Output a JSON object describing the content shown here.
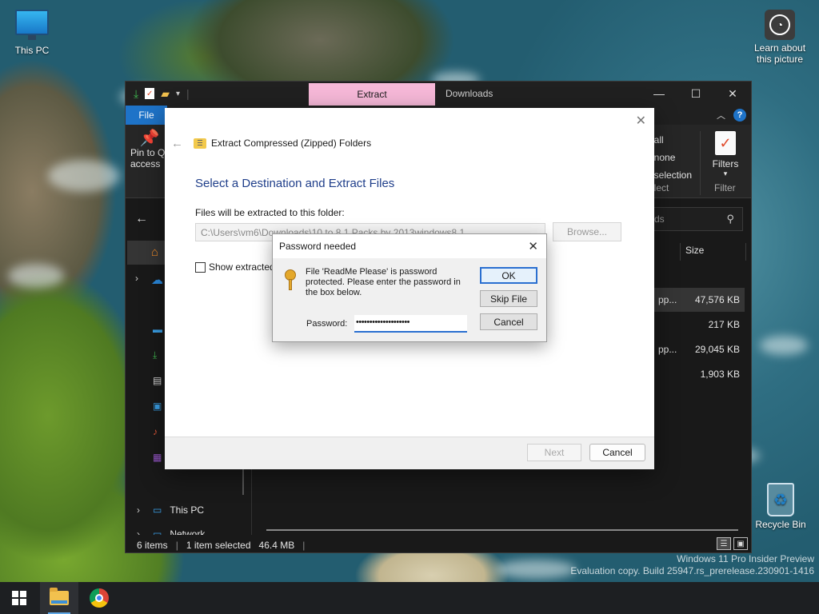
{
  "desktop": {
    "icons": [
      {
        "label": "This PC",
        "icon": "monitor-icon"
      },
      {
        "label": "Learn about\nthis picture",
        "icon": "camera-icon"
      },
      {
        "label": "Recycle Bin",
        "icon": "recycle-bin-icon"
      }
    ],
    "watermark": {
      "line1": "Windows 11 Pro Insider Preview",
      "line2": "Evaluation copy. Build 25947.rs_prerelease.230901-1416"
    }
  },
  "explorer": {
    "context_tab": "Extract",
    "title": "Downloads",
    "window_controls": {
      "minimize": "—",
      "maximize": "☐",
      "close": "✕"
    },
    "ribbon": {
      "file_tab": "File",
      "pin_label": "Pin to Quick access",
      "pin_label_visible": "Pin to Q\naccess",
      "select_items": [
        "ct all",
        "ct none",
        "ct selection"
      ],
      "select_items_visible": [
        "t all",
        "t none",
        "t selection"
      ],
      "select_group": "elect",
      "filters_label": "Filters",
      "filter_group": "Filter"
    },
    "search_placeholder": "ds",
    "nav": {
      "this_pc": "This PC",
      "network": "Network"
    },
    "list": {
      "size_header": "Size",
      "rows": [
        {
          "name": "pp...",
          "size": "47,576 KB",
          "selected": true
        },
        {
          "name": "",
          "size": "217 KB",
          "selected": false
        },
        {
          "name": "pp...",
          "size": "29,045 KB",
          "selected": false
        },
        {
          "name": "",
          "size": "1,903 KB",
          "selected": false
        }
      ]
    },
    "status": {
      "items": "6 items",
      "selection": "1 item selected",
      "size": "46.4 MB"
    }
  },
  "wizard": {
    "header": "Extract Compressed (Zipped) Folders",
    "title": "Select a Destination and Extract Files",
    "folder_label": "Files will be extracted to this folder:",
    "path": "C:\\Users\\vm6\\Downloads\\10 to 8.1 Packs by 2013windows8.1",
    "browse": "Browse...",
    "show_extracted": "Show extracted",
    "next": "Next",
    "cancel": "Cancel"
  },
  "password_dialog": {
    "title": "Password needed",
    "message": "File 'ReadMe Please' is password protected.  Please enter the password in the box below.",
    "ok": "OK",
    "skip": "Skip File",
    "cancel": "Cancel",
    "password_label": "Password:",
    "password_value": "••••••••••••••••••••"
  },
  "taskbar": {
    "apps": [
      "start-button",
      "file-explorer",
      "chrome"
    ]
  },
  "colors": {
    "accent": "#1e73c8",
    "extract_tab": "#f6b8d8",
    "wizard_title": "#1f3e8a"
  }
}
